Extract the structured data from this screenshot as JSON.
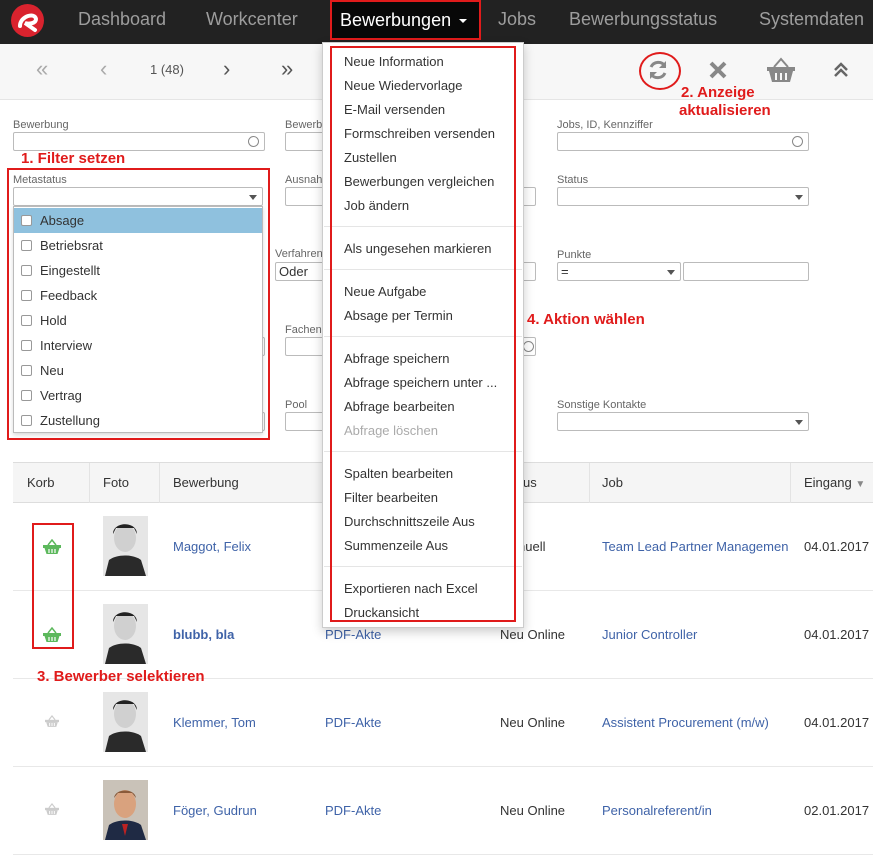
{
  "nav": {
    "items": [
      "Dashboard",
      "Workcenter",
      "Bewerbungen",
      "Jobs",
      "Bewerbungsstatus",
      "Systemdaten"
    ],
    "active": "Bewerbungen"
  },
  "pagination": {
    "page_label": "1 (48)"
  },
  "filters": {
    "bewerbung_label": "Bewerbung",
    "bewerb_label": "Bewerb",
    "jobs_label": "Jobs, ID, Kennziffer",
    "metastatus_label": "Metastatus",
    "ausnah_label": "Ausnah",
    "status_label": "Status",
    "verfahren_label": "Verfahren",
    "verfahren_value": "Oder",
    "punkte_label": "Punkte",
    "punkte_operator": "=",
    "fachen_label": "Fachen",
    "pool_label": "Pool",
    "sonstige_label": "Sonstige Kontakte"
  },
  "metastatus_options": [
    "Absage",
    "Betriebsrat",
    "Eingestellt",
    "Feedback",
    "Hold",
    "Interview",
    "Neu",
    "Vertrag",
    "Zustellung"
  ],
  "menu": {
    "group1": [
      "Neue Information",
      "Neue Wiedervorlage",
      "E-Mail versenden",
      "Formschreiben versenden",
      "Zustellen",
      "Bewerbungen vergleichen",
      "Job ändern"
    ],
    "group2": [
      "Als ungesehen markieren"
    ],
    "group3": [
      "Neue Aufgabe",
      "Absage per Termin"
    ],
    "group4": [
      "Abfrage speichern",
      "Abfrage speichern unter ...",
      "Abfrage bearbeiten",
      "Abfrage löschen"
    ],
    "group5": [
      "Spalten bearbeiten",
      "Filter bearbeiten",
      "Durchschnittszeile Aus",
      "Summenzeile Aus"
    ],
    "group6": [
      "Exportieren nach Excel",
      "Druckansicht"
    ]
  },
  "table": {
    "headers": [
      "Korb",
      "Foto",
      "Bewerbung",
      "us",
      "Job",
      "Eingang"
    ],
    "rows": [
      {
        "name": "Maggot, Felix",
        "akte": "",
        "status": "Manuell",
        "job": "Team Lead Partner Managemen",
        "date": "04.01.2017",
        "selected": true
      },
      {
        "name": "blubb, bla",
        "akte": "PDF-Akte",
        "status": "Neu Online",
        "job": "Junior Controller",
        "date": "04.01.2017",
        "selected": true
      },
      {
        "name": "Klemmer, Tom",
        "akte": "PDF-Akte",
        "status": "Neu Online",
        "job": "Assistent Procurement (m/w)",
        "date": "04.01.2017",
        "selected": false
      },
      {
        "name": "Föger, Gudrun",
        "akte": "PDF-Akte",
        "status": "Neu Online",
        "job": "Personalreferent/in",
        "date": "02.01.2017",
        "selected": false
      }
    ]
  },
  "annotations": {
    "a1": "1. Filter setzen",
    "a2_line1": "2. Anzeige",
    "a2_line2": "aktualisieren",
    "a3": "3. Bewerber selektieren",
    "a4": "4. Aktion wählen"
  },
  "colors": {
    "accent": "#e01b1b",
    "link": "#3f63a8",
    "basket_active": "#5cb85c",
    "navbar": "#222222"
  },
  "icons": [
    "logo-icon",
    "first-page-icon",
    "prev-page-icon",
    "next-page-icon",
    "last-page-icon",
    "refresh-icon",
    "close-icon",
    "basket-icon",
    "collapse-icon"
  ]
}
